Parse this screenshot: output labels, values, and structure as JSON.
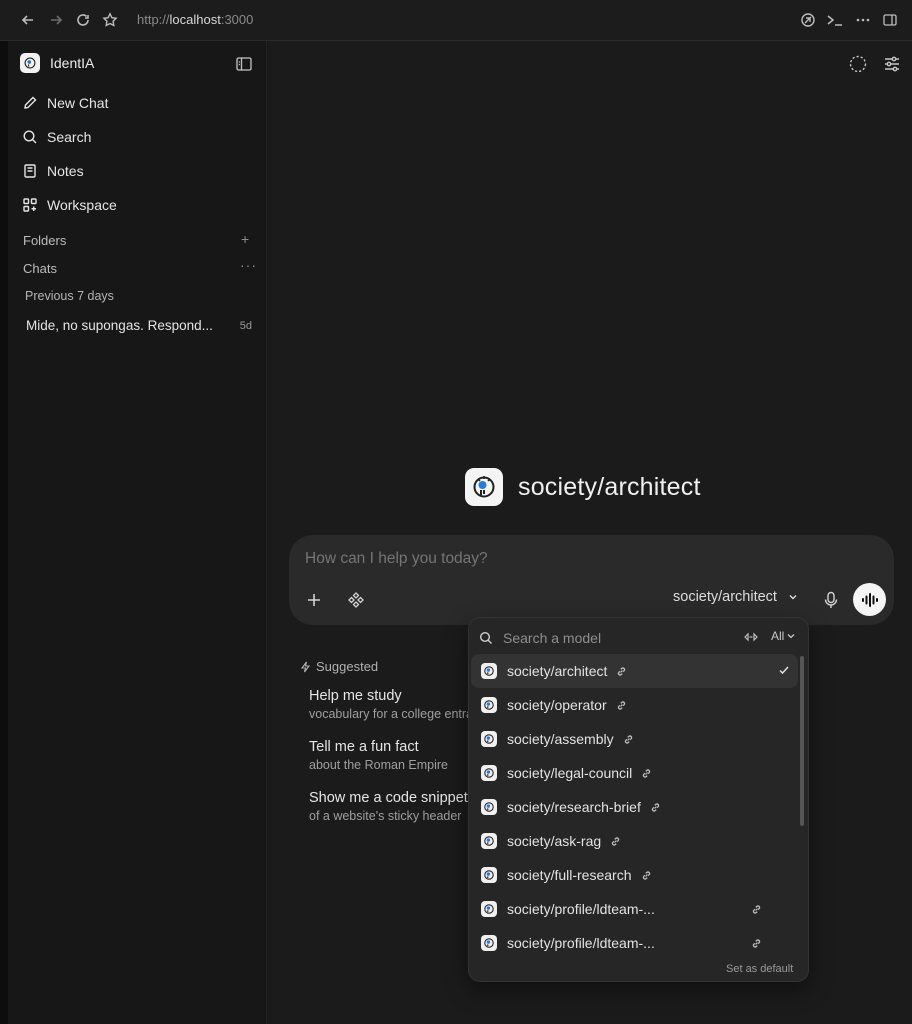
{
  "browser": {
    "url_scheme": "http://",
    "url_host": "localhost",
    "url_port": ":3000"
  },
  "sidebar": {
    "brand": "IdentIA",
    "nav": [
      {
        "label": "New Chat",
        "icon": "pencil-icon"
      },
      {
        "label": "Search",
        "icon": "search-icon"
      },
      {
        "label": "Notes",
        "icon": "notebook-icon"
      },
      {
        "label": "Workspace",
        "icon": "workspace-icon"
      }
    ],
    "folders_label": "Folders",
    "chats_label": "Chats",
    "group_label": "Previous 7 days",
    "chats": [
      {
        "title": "Mide, no supongas. Respond...",
        "age": "5d"
      }
    ]
  },
  "main": {
    "model_title": "society/architect",
    "composer": {
      "placeholder": "How can I help you today?",
      "selected_model": "society/architect"
    },
    "suggested_label": "Suggested",
    "suggestions": [
      {
        "title": "Help me study",
        "subtitle": "vocabulary for a college entrance exam"
      },
      {
        "title": "Tell me a fun fact",
        "subtitle": "about the Roman Empire"
      },
      {
        "title": "Show me a code snippet",
        "subtitle": "of a website's sticky header"
      }
    ]
  },
  "dropdown": {
    "search_placeholder": "Search a model",
    "filter_label": "All",
    "models": [
      {
        "name": "society/architect",
        "selected": true
      },
      {
        "name": "society/operator",
        "selected": false
      },
      {
        "name": "society/assembly",
        "selected": false
      },
      {
        "name": "society/legal-council",
        "selected": false
      },
      {
        "name": "society/research-brief",
        "selected": false
      },
      {
        "name": "society/ask-rag",
        "selected": false
      },
      {
        "name": "society/full-research",
        "selected": false
      },
      {
        "name": "society/profile/ldteam-...",
        "selected": false
      },
      {
        "name": "society/profile/ldteam-...",
        "selected": false
      }
    ],
    "footer": "Set as default"
  },
  "colors": {
    "background": "#171717",
    "main_background": "#1b1b1b",
    "composer": "#2a2a2a",
    "dropdown": "#262626",
    "logo_accent": "#2a7bd6"
  }
}
